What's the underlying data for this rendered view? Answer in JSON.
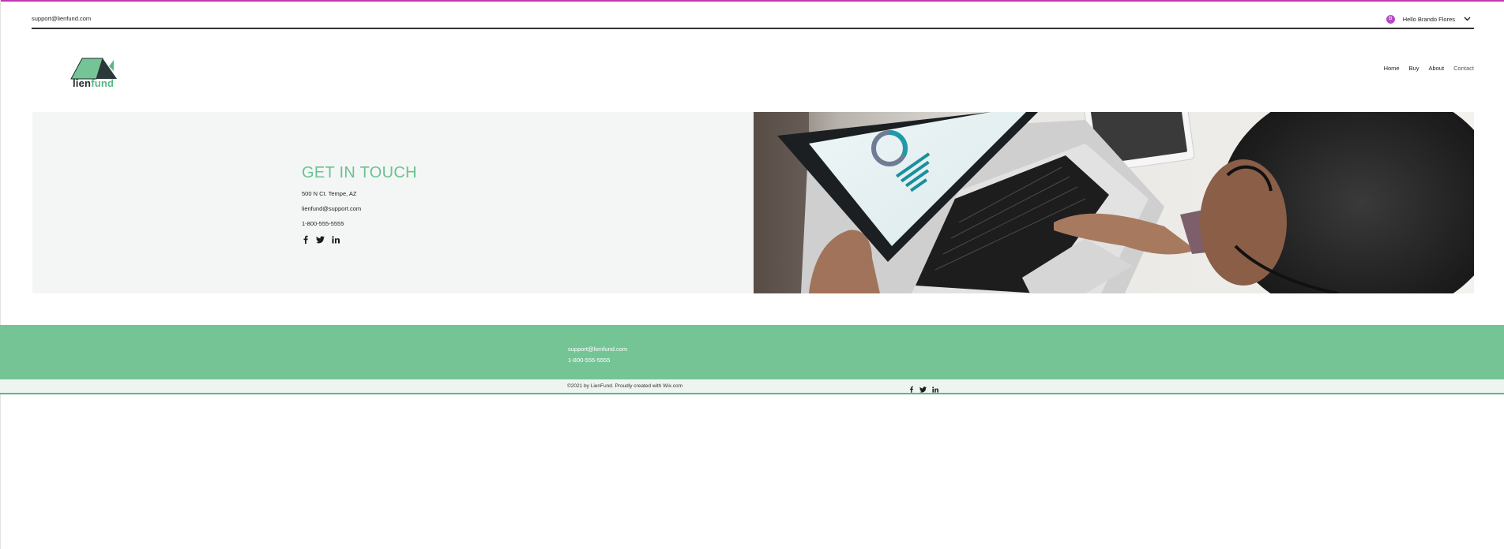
{
  "topbar": {
    "email": "support@lienfund.com",
    "user": {
      "avatar_initial": "B",
      "greeting": "Hello Brando Flores"
    }
  },
  "logo": {
    "word_lien": "lien",
    "word_fund": "fund"
  },
  "nav": {
    "items": [
      "Home",
      "Buy",
      "About",
      "Contact"
    ]
  },
  "contact": {
    "heading": "GET IN TOUCH",
    "address": "500 N Ct. Tempe, AZ",
    "email": "lienfund@support.com",
    "phone": "1-800-555-5555"
  },
  "footer": {
    "email": "support@lienfund.com",
    "phone": "1-800-555-5555",
    "copyright": "©2021 by LienFund. Proudly created with Wix.com"
  },
  "colors": {
    "brand_green": "#75c495",
    "accent_magenta": "#c236b0",
    "avatar_purple": "#b44cc6"
  },
  "icons": [
    "facebook-icon",
    "twitter-icon",
    "linkedin-icon",
    "chevron-down-icon"
  ]
}
